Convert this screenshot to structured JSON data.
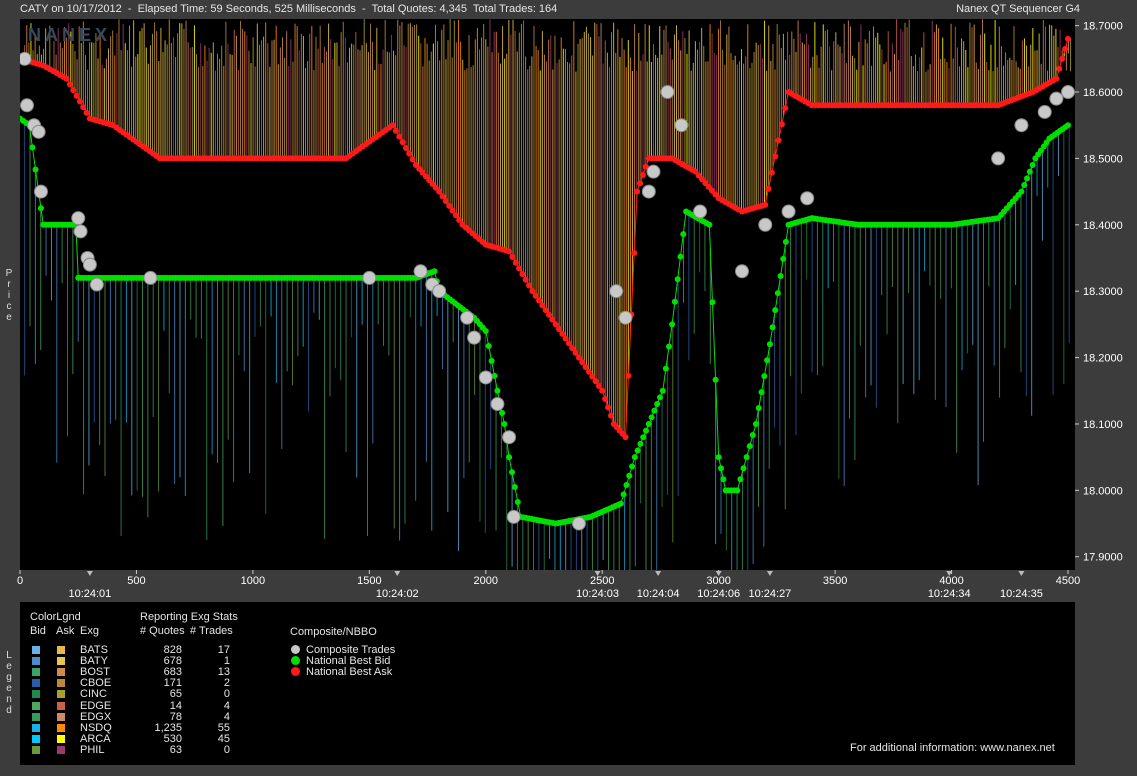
{
  "header": {
    "left": "CATY on 10/17/2012  -  Elapsed Time: 59 Seconds, 525 Milliseconds  -  Total Quotes: 4,345  Total Trades: 164",
    "right": "Nanex QT Sequencer G4",
    "watermark": "NANEX"
  },
  "y_axis_label": "Price",
  "legend_side_label": "Legend",
  "chart_data": {
    "type": "line",
    "ylabel": "Price",
    "ylim": [
      17.88,
      18.71
    ],
    "xlim": [
      0,
      4530
    ],
    "y_ticks": [
      "17.9000",
      "18.0000",
      "18.1000",
      "18.2000",
      "18.3000",
      "18.4000",
      "18.5000",
      "18.6000",
      "18.7000"
    ],
    "y_tick_values": [
      17.9,
      18.0,
      18.1,
      18.2,
      18.3,
      18.4,
      18.5,
      18.6,
      18.7
    ],
    "x_ticks": [
      "0",
      "500",
      "1000",
      "1500",
      "2000",
      "2500",
      "3000",
      "3500",
      "4000",
      "4500"
    ],
    "x_tick_values": [
      0,
      500,
      1000,
      1500,
      2000,
      2500,
      3000,
      3500,
      4000,
      4500
    ],
    "time_labels": [
      {
        "x": 300,
        "label": "10:24:01"
      },
      {
        "x": 1620,
        "label": "10:24:02"
      },
      {
        "x": 2480,
        "label": "10:24:03"
      },
      {
        "x": 2740,
        "label": "10:24:04"
      },
      {
        "x": 3000,
        "label": "10:24:06"
      },
      {
        "x": 3220,
        "label": "10:24:27"
      },
      {
        "x": 3990,
        "label": "10:24:34"
      },
      {
        "x": 4300,
        "label": "10:24:35"
      }
    ],
    "series": [
      {
        "name": "National Best Bid",
        "color": "#00e000",
        "points": [
          [
            0,
            18.56
          ],
          [
            40,
            18.55
          ],
          [
            80,
            18.45
          ],
          [
            100,
            18.4
          ],
          [
            240,
            18.4
          ],
          [
            250,
            18.32
          ],
          [
            400,
            18.32
          ],
          [
            500,
            18.32
          ],
          [
            800,
            18.32
          ],
          [
            1100,
            18.32
          ],
          [
            1400,
            18.32
          ],
          [
            1700,
            18.32
          ],
          [
            1780,
            18.33
          ],
          [
            1800,
            18.3
          ],
          [
            1950,
            18.26
          ],
          [
            2000,
            18.24
          ],
          [
            2050,
            18.15
          ],
          [
            2080,
            18.1
          ],
          [
            2100,
            18.05
          ],
          [
            2150,
            17.96
          ],
          [
            2300,
            17.95
          ],
          [
            2450,
            17.96
          ],
          [
            2580,
            17.98
          ],
          [
            2640,
            18.05
          ],
          [
            2700,
            18.1
          ],
          [
            2760,
            18.15
          ],
          [
            2800,
            18.25
          ],
          [
            2860,
            18.42
          ],
          [
            2960,
            18.4
          ],
          [
            3000,
            18.05
          ],
          [
            3030,
            18.0
          ],
          [
            3080,
            18.0
          ],
          [
            3120,
            18.05
          ],
          [
            3160,
            18.1
          ],
          [
            3220,
            18.22
          ],
          [
            3300,
            18.4
          ],
          [
            3400,
            18.41
          ],
          [
            3600,
            18.4
          ],
          [
            4000,
            18.4
          ],
          [
            4200,
            18.41
          ],
          [
            4300,
            18.45
          ],
          [
            4360,
            18.5
          ],
          [
            4420,
            18.53
          ],
          [
            4500,
            18.55
          ]
        ]
      },
      {
        "name": "National Best Ask",
        "color": "#ff1a1a",
        "points": [
          [
            0,
            18.65
          ],
          [
            100,
            18.64
          ],
          [
            200,
            18.62
          ],
          [
            300,
            18.56
          ],
          [
            400,
            18.55
          ],
          [
            600,
            18.5
          ],
          [
            800,
            18.5
          ],
          [
            1000,
            18.5
          ],
          [
            1200,
            18.5
          ],
          [
            1400,
            18.5
          ],
          [
            1600,
            18.55
          ],
          [
            1700,
            18.49
          ],
          [
            1800,
            18.45
          ],
          [
            1900,
            18.4
          ],
          [
            2000,
            18.37
          ],
          [
            2100,
            18.36
          ],
          [
            2200,
            18.3
          ],
          [
            2300,
            18.25
          ],
          [
            2400,
            18.2
          ],
          [
            2500,
            18.15
          ],
          [
            2550,
            18.1
          ],
          [
            2600,
            18.08
          ],
          [
            2650,
            18.45
          ],
          [
            2700,
            18.5
          ],
          [
            2800,
            18.5
          ],
          [
            2900,
            18.48
          ],
          [
            3000,
            18.44
          ],
          [
            3100,
            18.42
          ],
          [
            3200,
            18.43
          ],
          [
            3300,
            18.6
          ],
          [
            3400,
            18.58
          ],
          [
            3600,
            18.58
          ],
          [
            3800,
            18.58
          ],
          [
            4000,
            18.58
          ],
          [
            4200,
            18.58
          ],
          [
            4350,
            18.6
          ],
          [
            4450,
            18.62
          ],
          [
            4500,
            18.68
          ]
        ]
      },
      {
        "name": "Composite Trades",
        "color": "#c8c8c8",
        "points": [
          [
            20,
            18.65
          ],
          [
            30,
            18.58
          ],
          [
            60,
            18.55
          ],
          [
            80,
            18.54
          ],
          [
            90,
            18.45
          ],
          [
            250,
            18.41
          ],
          [
            260,
            18.39
          ],
          [
            290,
            18.35
          ],
          [
            300,
            18.34
          ],
          [
            330,
            18.31
          ],
          [
            560,
            18.32
          ],
          [
            1500,
            18.32
          ],
          [
            1720,
            18.33
          ],
          [
            1770,
            18.31
          ],
          [
            1800,
            18.3
          ],
          [
            1920,
            18.26
          ],
          [
            1950,
            18.23
          ],
          [
            2000,
            18.17
          ],
          [
            2050,
            18.13
          ],
          [
            2100,
            18.08
          ],
          [
            2120,
            17.96
          ],
          [
            2400,
            17.95
          ],
          [
            2560,
            18.3
          ],
          [
            2600,
            18.26
          ],
          [
            2700,
            18.45
          ],
          [
            2720,
            18.48
          ],
          [
            2780,
            18.6
          ],
          [
            2840,
            18.55
          ],
          [
            2920,
            18.42
          ],
          [
            3100,
            18.33
          ],
          [
            3200,
            18.4
          ],
          [
            3300,
            18.42
          ],
          [
            3380,
            18.44
          ],
          [
            4200,
            18.5
          ],
          [
            4300,
            18.55
          ],
          [
            4400,
            18.57
          ],
          [
            4450,
            18.59
          ],
          [
            4500,
            18.6
          ]
        ]
      }
    ]
  },
  "legend": {
    "colorlgnd": "ColorLgnd",
    "reporting": "Reporting Exg Stats",
    "col_bid": "Bid",
    "col_ask": "Ask",
    "col_exg": "Exg",
    "col_quotes": "# Quotes",
    "col_trades": "# Trades",
    "composite_title": "Composite/NBBO",
    "rows": [
      {
        "exg": "BATS",
        "quotes": "828",
        "trades": "17",
        "bid": "#66b3e6",
        "ask": "#e6b84d"
      },
      {
        "exg": "BATY",
        "quotes": "678",
        "trades": "1",
        "bid": "#4d8ccc",
        "ask": "#e6c84d"
      },
      {
        "exg": "BOST",
        "quotes": "683",
        "trades": "13",
        "bid": "#3aa36a",
        "ask": "#d08a4d"
      },
      {
        "exg": "CBOE",
        "quotes": "171",
        "trades": "2",
        "bid": "#2a5fa8",
        "ask": "#b88a3a"
      },
      {
        "exg": "CINC",
        "quotes": "65",
        "trades": "0",
        "bid": "#1f8a4d",
        "ask": "#a8a02a"
      },
      {
        "exg": "EDGE",
        "quotes": "14",
        "trades": "4",
        "bid": "#4da860",
        "ask": "#c8604d"
      },
      {
        "exg": "EDGX",
        "quotes": "78",
        "trades": "4",
        "bid": "#3a9a5a",
        "ask": "#cc8a6a"
      },
      {
        "exg": "NSDQ",
        "quotes": "1,235",
        "trades": "55",
        "bid": "#19b0e6",
        "ask": "#ff8c00"
      },
      {
        "exg": "ARCA",
        "quotes": "530",
        "trades": "45",
        "bid": "#00c8ff",
        "ask": "#ffff00"
      },
      {
        "exg": "PHIL",
        "quotes": "63",
        "trades": "0",
        "bid": "#6a9a3a",
        "ask": "#9a3a6a"
      }
    ],
    "composite": [
      {
        "label": "Composite Trades",
        "color": "#c8c8c8"
      },
      {
        "label": "National Best Bid",
        "color": "#00e000"
      },
      {
        "label": "National Best Ask",
        "color": "#ff1a1a"
      }
    ],
    "footer": "For additional information: www.nanex.net"
  }
}
